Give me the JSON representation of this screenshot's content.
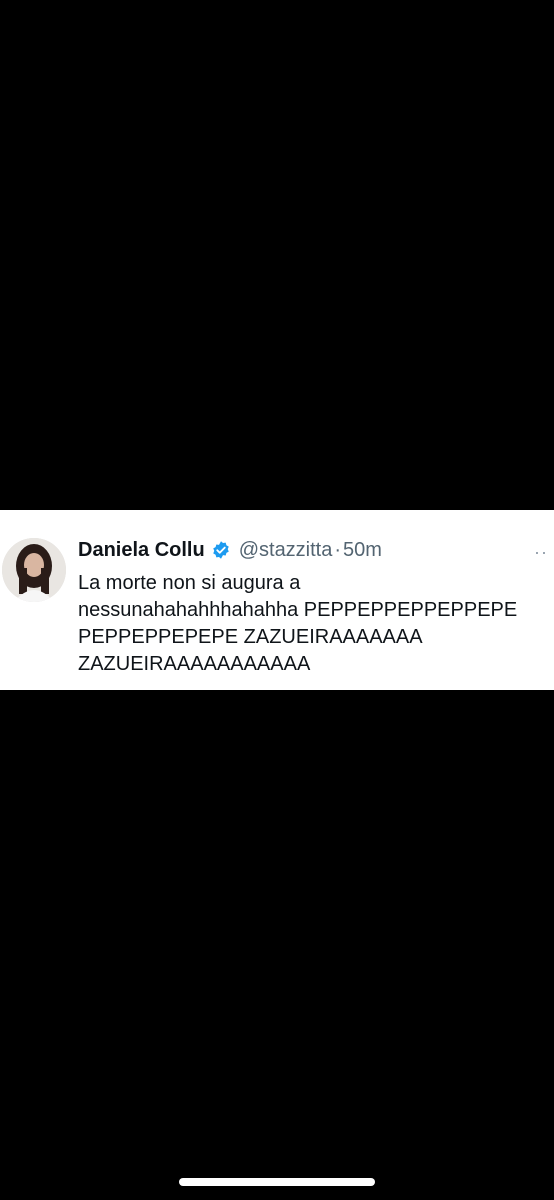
{
  "tweet": {
    "author_name": "Daniela Collu",
    "handle": "@stazzitta",
    "separator": "·",
    "time": "50m",
    "more_icon": "more-icon",
    "verified_icon": "verified-badge-icon",
    "text_lines": [
      "La morte non si augura a",
      "nessunahahahhhahahha PEPPEPPEPPEPPEPE",
      "PEPPEPPEPEPE ZAZUEIRAAAAAAA",
      "ZAZUEIRAAAAAAAAAAA"
    ],
    "verified_color": "#1d9bf0"
  }
}
